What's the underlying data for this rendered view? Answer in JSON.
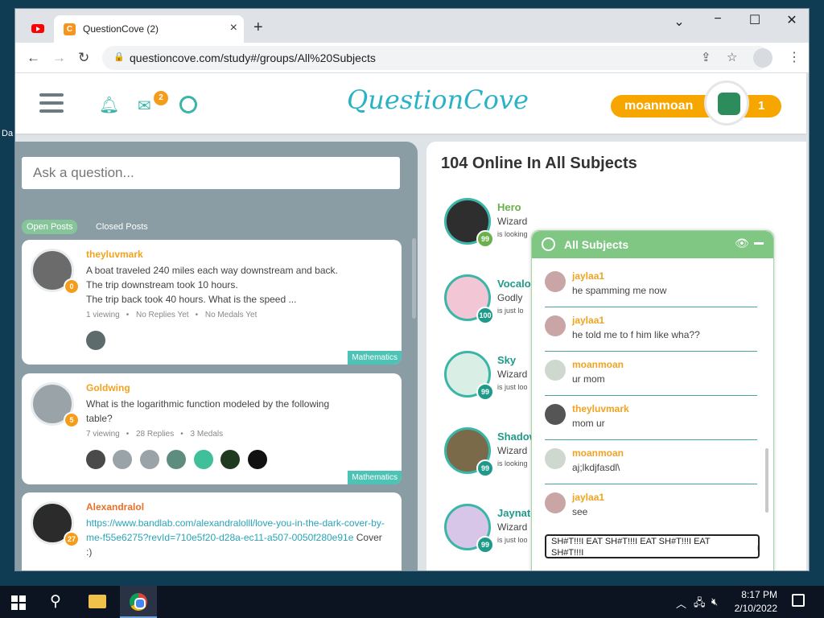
{
  "desktop": {
    "icon_label": "Da"
  },
  "browser": {
    "tabs": [
      {
        "title": "",
        "icon": "youtube-icon"
      },
      {
        "title": "QuestionCove (2)",
        "icon": "questioncove-favicon",
        "active": true
      }
    ],
    "new_tab_label": "+",
    "controls": {
      "minimize": "−",
      "maximize": "☐",
      "close": "✕",
      "dropdown": "⌄"
    },
    "url": "questioncove.com/study#/groups/All%20Subjects"
  },
  "site": {
    "logo_text": "QuestionCove",
    "mail_badge": "2",
    "username": "moanmoan",
    "user_score": "1",
    "ask_placeholder": "Ask a question...",
    "post_tabs": [
      "Open Posts",
      "Closed Posts"
    ],
    "posts": [
      {
        "user": "theyluvmark",
        "badge": "0",
        "lines": [
          "A boat traveled 240 miles each way downstream and back.",
          "The trip downstream took 10 hours.",
          "The trip back took 40 hours.  What is the speed ..."
        ],
        "meta": [
          "1 viewing",
          "No Replies Yet",
          "No Medals Yet"
        ],
        "tag": "Mathematics"
      },
      {
        "user": "Goldwing",
        "badge": "5",
        "lines": [
          "What is the logarithmic function modeled by the following",
          "table?"
        ],
        "meta": [
          "7 viewing",
          "28 Replies",
          "3 Medals"
        ],
        "tag": "Mathematics"
      },
      {
        "user": "Alexandralol",
        "badge": "27",
        "link": "https://www.bandlab.com/alexandralolll/love-you-in-the-dark-cover-by-me-f55e6275?revId=710e5f20-d28a-ec11-a507-0050f280e91e",
        "link_suffix": "Cover :)"
      }
    ],
    "online_title": "104 Online In All Subjects",
    "online_users": [
      {
        "name": "Hero",
        "rank": "Wizard",
        "status": "is looking",
        "score": "99",
        "color": "#6ab04c"
      },
      {
        "name": "Vocaloid",
        "rank": "Godly",
        "status": "is just lo",
        "score": "100",
        "color": "#1f9a8a"
      },
      {
        "name": "Sky",
        "rank": "Wizard",
        "status": "is just loo",
        "score": "99",
        "color": "#1f9a8a"
      },
      {
        "name": "Shadow",
        "rank": "Wizard",
        "status": "is looking",
        "score": "99",
        "color": "#1f9a8a"
      },
      {
        "name": "Jaynator",
        "rank": "Wizard",
        "status": "is just loo",
        "score": "99",
        "color": "#1f9a8a"
      }
    ],
    "chat": {
      "title": "All Subjects",
      "messages": [
        {
          "user": "jaylaa1",
          "text": "he spamming me now"
        },
        {
          "user": "jaylaa1",
          "text": "he told me to f him like wha??"
        },
        {
          "user": "moanmoan",
          "text": "ur mom"
        },
        {
          "user": "theyluvmark",
          "text": "mom ur"
        },
        {
          "user": "moanmoan",
          "text": "aj;lkdjfasdl\\"
        },
        {
          "user": "jaylaa1",
          "text": "see"
        }
      ],
      "input_value": "SH#T!!!I EAT SH#T!!!I EAT SH#T!!!I EAT SH#T!!!I"
    }
  },
  "taskbar": {
    "time": "8:17 PM",
    "date": "2/10/2022"
  },
  "colors": {
    "accent": "#3ab5a8",
    "brand_orange": "#f7a600",
    "chat_header": "#81c784"
  }
}
